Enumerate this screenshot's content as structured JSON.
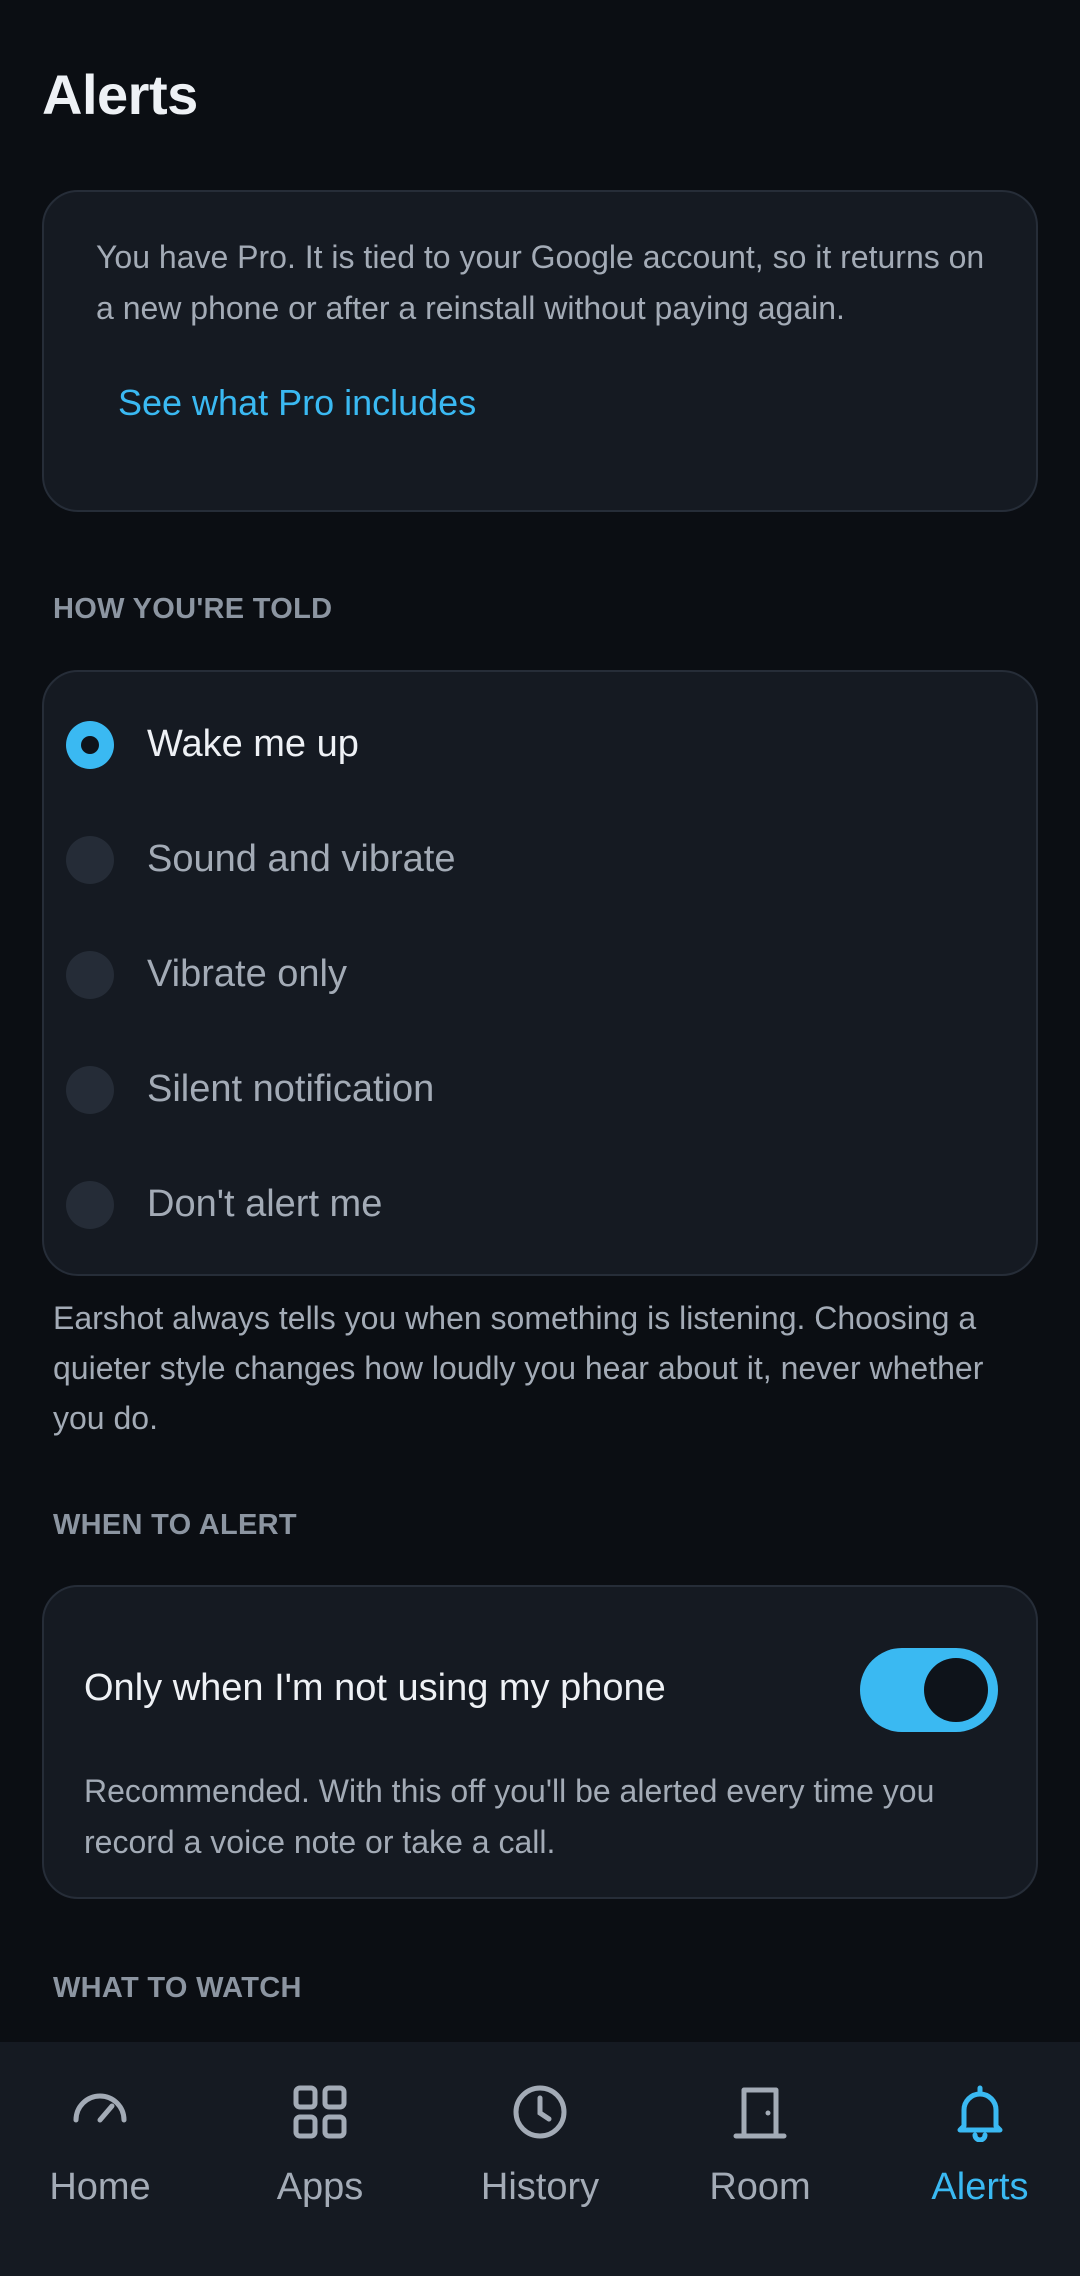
{
  "header": {
    "title": "Alerts"
  },
  "pro_card": {
    "text": "You have Pro. It is tied to your Google account, so it returns on a new phone or after a reinstall without paying again.",
    "link_label": "See what Pro includes"
  },
  "how_told": {
    "heading": "HOW YOU'RE TOLD",
    "options": [
      {
        "label": "Wake me up",
        "selected": true
      },
      {
        "label": "Sound and vibrate",
        "selected": false
      },
      {
        "label": "Vibrate only",
        "selected": false
      },
      {
        "label": "Silent notification",
        "selected": false
      },
      {
        "label": "Don't alert me",
        "selected": false
      }
    ],
    "helper": "Earshot always tells you when something is listening. Choosing a quieter style changes how loudly you hear about it, never whether you do."
  },
  "when_to_alert": {
    "heading": "WHEN TO ALERT",
    "toggle_label": "Only when I'm not using my phone",
    "toggle_on": true,
    "description": "Recommended. With this off you'll be alerted every time you record a voice note or take a call."
  },
  "what_to_watch": {
    "heading": "WHAT TO WATCH"
  },
  "nav": {
    "items": [
      {
        "label": "Home",
        "icon": "gauge-icon",
        "active": false
      },
      {
        "label": "Apps",
        "icon": "grid-icon",
        "active": false
      },
      {
        "label": "History",
        "icon": "clock-icon",
        "active": false
      },
      {
        "label": "Room",
        "icon": "door-icon",
        "active": false
      },
      {
        "label": "Alerts",
        "icon": "bell-icon",
        "active": true
      }
    ]
  },
  "colors": {
    "background": "#0b0e13",
    "card": "#151a22",
    "accent": "#3ab9f2",
    "muted_text": "#a3abb6"
  }
}
